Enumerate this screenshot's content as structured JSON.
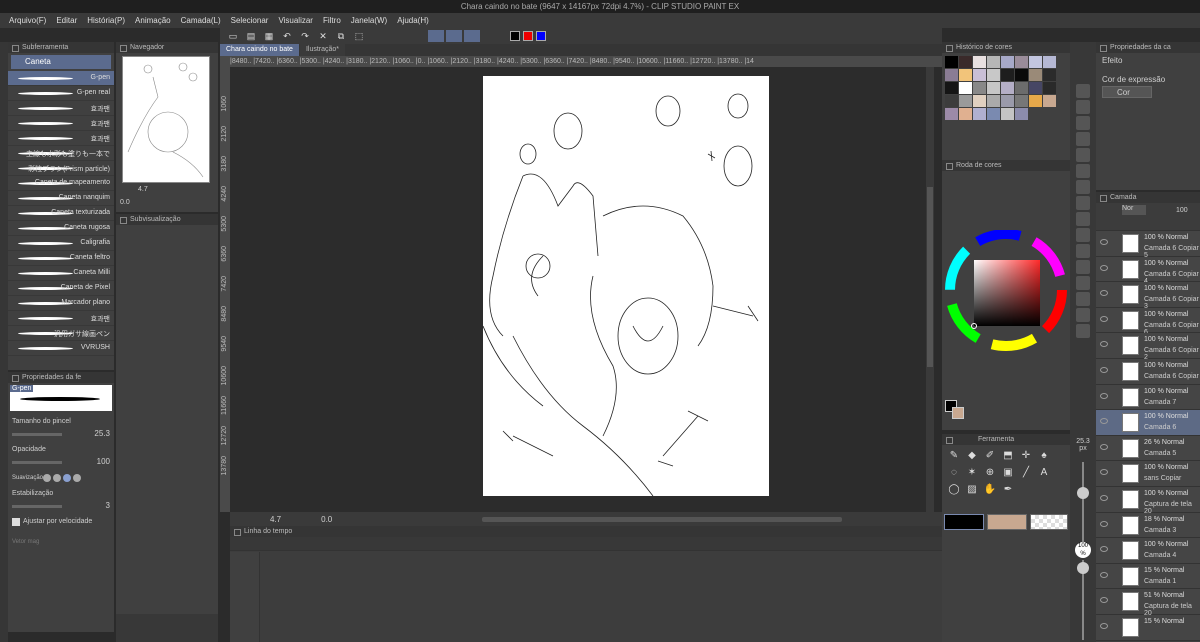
{
  "window_title": "Chara caindo no bate (9647 x 14167px 72dpi 4.7%) - CLIP STUDIO PAINT EX",
  "menu": [
    "Arquivo(F)",
    "Editar",
    "História(P)",
    "Animação",
    "Camada(L)",
    "Selecionar",
    "Visualizar",
    "Filtro",
    "Janela(W)",
    "Ajuda(H)"
  ],
  "subtool": {
    "header": "Subferramenta",
    "tab": "Caneta",
    "brushes": [
      "G-pen",
      "G-pen real",
      "효과팬",
      "효과팬",
      "효과팬",
      "主線も水彩も塗りも一本で",
      "彩粒ブラシ(Prism particle)",
      "Caneta de mapeamento",
      "Caneta nanquim",
      "Caneta texturizada",
      "Caneta rugosa",
      "Caligrafia",
      "Caneta feltro",
      "Caneta Milli",
      "Caneta de Pixel",
      "Marcador plano",
      "효과팬",
      "汎用ガサ線画ペン",
      "VVRUSH"
    ]
  },
  "navigator": {
    "header": "Navegador",
    "zoom": "4.7",
    "rotation": "0.0"
  },
  "subview": {
    "header": "Subvisualização"
  },
  "tool_props": {
    "header": "Propriedades da fe",
    "brush_name": "G-pen",
    "size_label": "Tamanho do pincel",
    "size_value": "25.3",
    "opacity_label": "Opacidade",
    "opacity_value": "100",
    "smoothing_label": "Suavização",
    "stabilization_label": "Estabilização",
    "stabilization_value": "3",
    "speed_label": "Ajustar por velocidade",
    "vector_label": "Vetor mag"
  },
  "doc_tabs": [
    "Chara caindo no bate",
    "Ilustração*"
  ],
  "ruler_top": "|8480.. |7420.. |6360.. |5300.. |4240.. |3180.. |2120.. |1060.. |0.. |1060.. |2120.. |3180.. |4240.. |5300.. |6360.. |7420.. |8480.. |9540.. |10600.. |11660.. |12720.. |13780.. |14",
  "ruler_left": [
    "1060",
    "2120",
    "3180",
    "4240",
    "5300",
    "6360",
    "7420",
    "8480",
    "9540",
    "10600",
    "11660",
    "12720",
    "13780"
  ],
  "canvas_status": {
    "zoom": "4.7",
    "rotation": "0.0"
  },
  "timeline": {
    "header": "Linha do tempo"
  },
  "color_history": {
    "header": "Histórico de cores",
    "colors": [
      "#000000",
      "#3a2a2a",
      "#e8e0e0",
      "#b6b6b6",
      "#a7a9c8",
      "#9a8c9a",
      "#c3c6e0",
      "#b5b8d4",
      "#8a7c94",
      "#f2c47a",
      "#c9bfd6",
      "#c8c8c8",
      "#1e1e1e",
      "#0a0a0a",
      "#9a8a78",
      "#2b2b2b",
      "#151515",
      "#ffffff",
      "#888888",
      "#c6c6c6",
      "#b4aec6",
      "#6c6c6c",
      "#464664",
      "#2a2a2a",
      "#3c3c3c",
      "#9a9a9a",
      "#e0d0c0",
      "#aaaaaa",
      "#9a9aaa",
      "#777777",
      "#e6a84a",
      "#c8a890",
      "#9c8aa8",
      "#e0b090",
      "#b0b0d0",
      "#7a8ab0",
      "#c4c4c4",
      "#8c8cac"
    ]
  },
  "color_wheel": {
    "header": "Roda de cores",
    "hue": "#ff2a2a"
  },
  "tool_panel": {
    "header": "Ferramenta"
  },
  "layer_props": {
    "header": "Propriedades da ca",
    "effect_label": "Efeito",
    "expression_label": "Cor de expressão",
    "expression_value": "Cor"
  },
  "layer_panel": {
    "header": "Camada",
    "blend": "Nor",
    "opacity": "100"
  },
  "layers": [
    {
      "pct": "100 % Normal",
      "name": "Camada 6 Copiar 5"
    },
    {
      "pct": "100 % Normal",
      "name": "Camada 6 Copiar 4"
    },
    {
      "pct": "100 % Normal",
      "name": "Camada 6 Copiar 3"
    },
    {
      "pct": "100 % Normal",
      "name": "Camada 6 Copiar 6"
    },
    {
      "pct": "100 % Normal",
      "name": "Camada 6 Copiar 2"
    },
    {
      "pct": "100 % Normal",
      "name": "Camada 6 Copiar"
    },
    {
      "pct": "100 % Normal",
      "name": "Camada 7"
    },
    {
      "pct": "100 % Normal",
      "name": "Camada 6",
      "selected": true
    },
    {
      "pct": "26 % Normal",
      "name": "Camada 5"
    },
    {
      "pct": "100 % Normal",
      "name": "sans Copiar"
    },
    {
      "pct": "100 % Normal",
      "name": "Captura de tela 20"
    },
    {
      "pct": "18 % Normal",
      "name": "Camada 3"
    },
    {
      "pct": "100 % Normal",
      "name": "Camada 4"
    },
    {
      "pct": "15 % Normal",
      "name": "Camada 1"
    },
    {
      "pct": "51 % Normal",
      "name": "Captura de tela 20"
    },
    {
      "pct": "15 % Normal",
      "name": ""
    }
  ],
  "brush_size_right": {
    "value": "25.3",
    "unit": "px"
  },
  "opacity_right": {
    "value": "100",
    "unit": "%"
  }
}
